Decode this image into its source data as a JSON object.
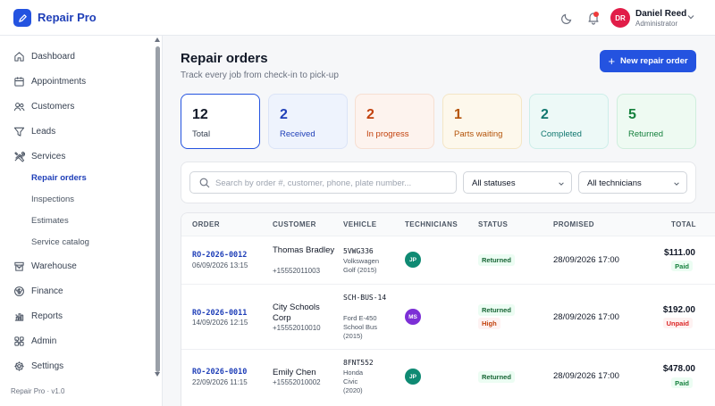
{
  "app": {
    "brand": "Repair Pro",
    "version": "Repair Pro · v1.0"
  },
  "user": {
    "initials": "DR",
    "name": "Daniel Reed",
    "role": "Administrator"
  },
  "sidebar": {
    "items": [
      {
        "label": "Dashboard",
        "icon": "home-icon"
      },
      {
        "label": "Appointments",
        "icon": "calendar-icon"
      },
      {
        "label": "Customers",
        "icon": "users-icon"
      },
      {
        "label": "Leads",
        "icon": "filter-icon"
      },
      {
        "label": "Services",
        "icon": "tools-icon",
        "expanded": true
      },
      {
        "label": "Warehouse",
        "icon": "warehouse-icon"
      },
      {
        "label": "Finance",
        "icon": "dollar-icon"
      },
      {
        "label": "Reports",
        "icon": "bar-chart-icon"
      },
      {
        "label": "Admin",
        "icon": "grid-icon"
      },
      {
        "label": "Settings",
        "icon": "gear-icon"
      }
    ],
    "services_sub": [
      "Repair orders",
      "Inspections",
      "Estimates",
      "Service catalog"
    ],
    "active_sub": "Repair orders"
  },
  "page": {
    "title": "Repair orders",
    "subtitle": "Track every job from check-in to pick-up",
    "new_button": "New repair order"
  },
  "stats": [
    {
      "value": "12",
      "label": "Total",
      "color": "#111827",
      "bg": "#ffffff",
      "border": "#2453e0"
    },
    {
      "value": "2",
      "label": "Received",
      "color": "#1f3fb8",
      "bg": "#eef3fd",
      "border": "#dbe4f7"
    },
    {
      "value": "2",
      "label": "In progress",
      "color": "#c2410c",
      "bg": "#fdf3ee",
      "border": "#f6dfd2"
    },
    {
      "value": "1",
      "label": "Parts waiting",
      "color": "#b45309",
      "bg": "#fdf8ec",
      "border": "#f4e6c6"
    },
    {
      "value": "2",
      "label": "Completed",
      "color": "#0f766e",
      "bg": "#edf9f7",
      "border": "#cdeee9"
    },
    {
      "value": "5",
      "label": "Returned",
      "color": "#15803d",
      "bg": "#eefaf2",
      "border": "#cfeedd"
    }
  ],
  "filters": {
    "search_placeholder": "Search by order #, customer, phone, plate number...",
    "status_select": "All statuses",
    "tech_select": "All technicians"
  },
  "table": {
    "headers": [
      "ORDER",
      "CUSTOMER",
      "VEHICLE",
      "TECHNICIANS",
      "STATUS",
      "PROMISED",
      "TOTAL"
    ],
    "rows": [
      {
        "id": "RO-2026-0012",
        "date": "06/09/2026 13:15",
        "customer": "Thomas Bradley",
        "phone": "+15552011003",
        "plate": "5VWG336",
        "vehicle": "Volkswagen Golf (2015)",
        "tech": "JP",
        "tech_color": "#0f8a73",
        "status": [
          "Returned"
        ],
        "promised": "28/09/2026 17:00",
        "total": "$111.00",
        "payment": "Paid"
      },
      {
        "id": "RO-2026-0011",
        "date": "14/09/2026 12:15",
        "customer": "City Schools Corp",
        "phone": "+15552010010",
        "plate": "SCH-BUS-14",
        "vehicle": "Ford E-450 School Bus (2015)",
        "tech": "MS",
        "tech_color": "#7c2fd6",
        "status": [
          "Returned",
          "High"
        ],
        "promised": "28/09/2026 17:00",
        "total": "$192.00",
        "payment": "Unpaid"
      },
      {
        "id": "RO-2026-0010",
        "date": "22/09/2026 11:15",
        "customer": "Emily Chen",
        "phone": "+15552010002",
        "plate": "8FNT552",
        "vehicle": "Honda Civic (2020)",
        "tech": "JP",
        "tech_color": "#0f8a73",
        "status": [
          "Returned"
        ],
        "promised": "28/09/2026 17:00",
        "total": "$478.00",
        "payment": "Paid"
      }
    ]
  }
}
